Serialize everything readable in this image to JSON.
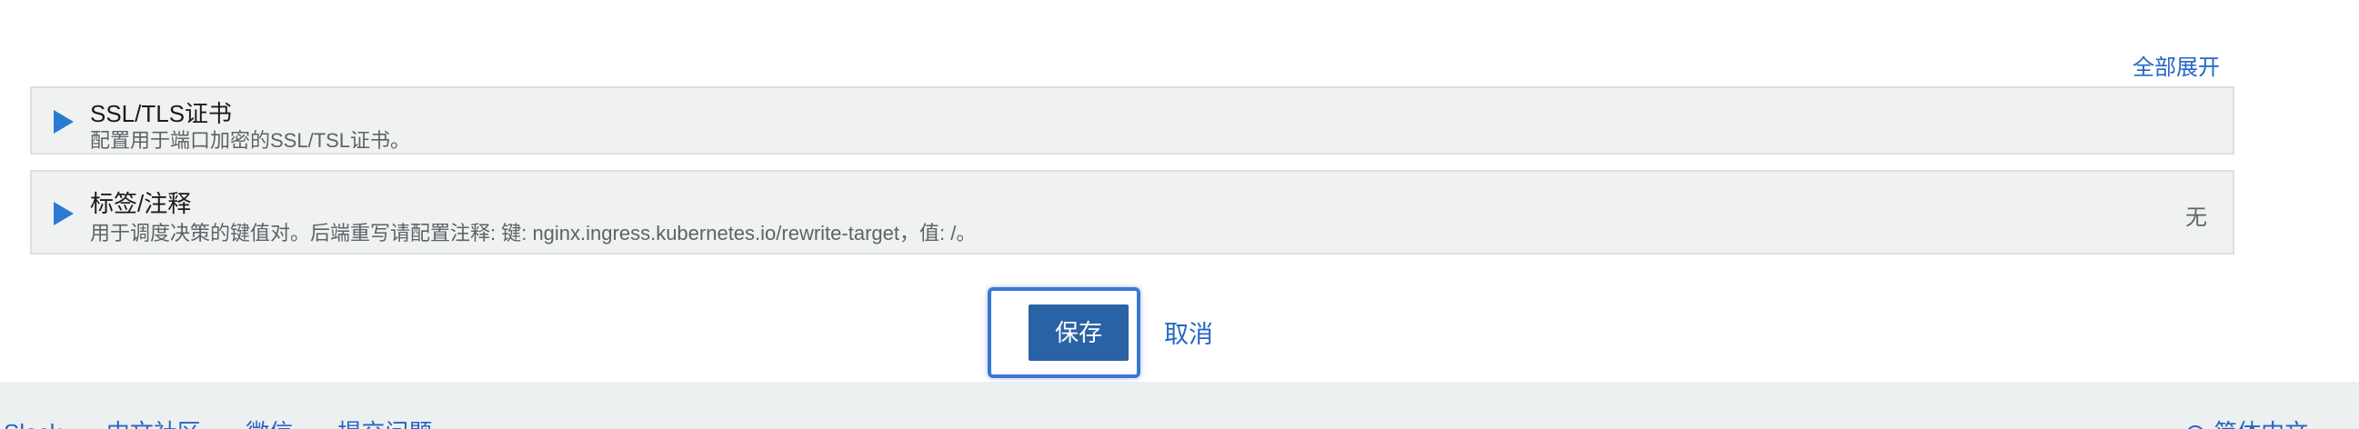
{
  "expand_all_label": "全部展开",
  "sections": [
    {
      "title": "SSL/TLS证书",
      "description": "配置用于端口加密的SSL/TSL证书。",
      "value": ""
    },
    {
      "title": "标签/注释",
      "description": "用于调度决策的键值对。后端重写请配置注释: 键: nginx.ingress.kubernetes.io/rewrite-target，值: /。",
      "value": "无"
    }
  ],
  "actions": {
    "save_label": "保存",
    "cancel_label": "取消"
  },
  "footer": {
    "links": [
      "Slack",
      "中文社区",
      "微信",
      "提交问题"
    ],
    "language": "简体中文",
    "language_icon": "globe-icon",
    "language_chevron": "chevron-down-icon"
  },
  "colors": {
    "accent": "#2566c5",
    "primary_button": "#2a62a6",
    "focus_ring": "#3a78d4",
    "section_bg": "#f0f2f2",
    "footer_bg": "#edf0f0"
  }
}
